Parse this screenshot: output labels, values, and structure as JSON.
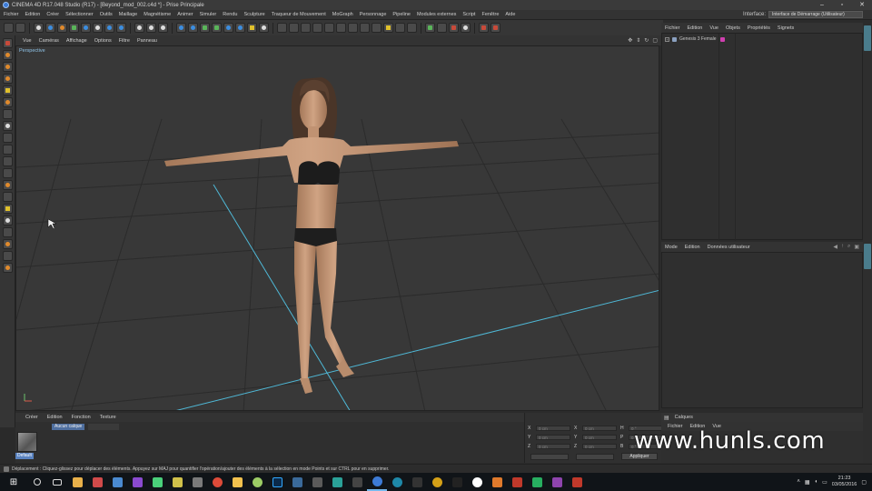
{
  "window": {
    "title": "CINEMA 4D R17.048 Studio (R17) - [Beyond_mod_002.c4d *] - Prise Principale"
  },
  "menubar": {
    "items": [
      "Fichier",
      "Edition",
      "Créer",
      "Sélectionner",
      "Outils",
      "Maillage",
      "Magnétisme",
      "Animer",
      "Simuler",
      "Rendu",
      "Sculpture",
      "Traqueur de Mouvement",
      "MoGraph",
      "Personnage",
      "Pipeline",
      "Modules externes",
      "Script",
      "Fenêtre",
      "Aide"
    ],
    "layout_label": "Interface:",
    "layout_value": "Interface de Démarrage (Utilisateur)"
  },
  "viewport": {
    "menu": [
      "Vue",
      "Caméras",
      "Affichage",
      "Options",
      "Filtre",
      "Panneau"
    ],
    "camera_label": "Perspective"
  },
  "material_manager": {
    "menu": [
      "Créer",
      "Edition",
      "Fonction",
      "Texture"
    ],
    "tab_active": "Aucun calque",
    "material_name": "Default"
  },
  "coordinates": {
    "rows": [
      {
        "a": "X",
        "a_val": "0 cm",
        "b": "X",
        "b_val": "0 cm",
        "c": "H",
        "c_val": "0 °"
      },
      {
        "a": "Y",
        "a_val": "0 cm",
        "b": "Y",
        "b_val": "0 cm",
        "c": "P",
        "c_val": "0 °"
      },
      {
        "a": "Z",
        "a_val": "0 cm",
        "b": "Z",
        "b_val": "0 cm",
        "c": "B",
        "c_val": "0 °"
      }
    ],
    "apply_label": "Appliquer"
  },
  "object_manager": {
    "menu": [
      "Fichier",
      "Edition",
      "Vue",
      "Objets",
      "Propriétés",
      "Signets"
    ],
    "objects": [
      {
        "name": "Genesis 3 Female"
      }
    ]
  },
  "attribute_manager": {
    "menu": [
      "Mode",
      "Edition",
      "Données utilisateur"
    ]
  },
  "layer_manager": {
    "title": "Calques",
    "menu": [
      "Fichier",
      "Edition",
      "Vue"
    ]
  },
  "statusbar": {
    "text": "Déplacement : Cliquez-glissez pour déplacer des éléments. Appuyez sur MAJ pour quantifier l'opération/ajouter des éléments à la sélection en mode Points et sur CTRL pour en supprimer."
  },
  "taskbar": {
    "time": "21:23",
    "date": "03/05/2016"
  },
  "watermark": "www.hunls.com",
  "colors": {
    "accent": "#5a83c0",
    "grid_axis": "#4fb8d6",
    "tag": "#d03fb0"
  }
}
